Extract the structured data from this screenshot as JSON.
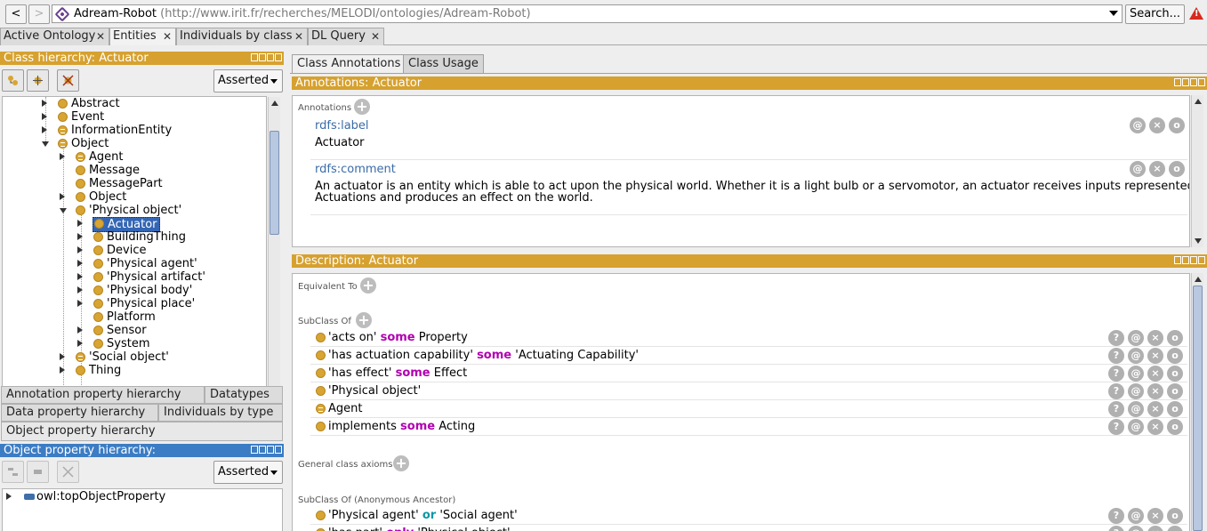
{
  "address_bar": {
    "back": "<",
    "forward": ">",
    "ontology_name": "Adream-Robot",
    "ontology_iri": "(http://www.irit.fr/recherches/MELODI/ontologies/Adream-Robot)",
    "search_label": "Search..."
  },
  "main_tabs": [
    {
      "label": "Active Ontology"
    },
    {
      "label": "Entities"
    },
    {
      "label": "Individuals by class"
    },
    {
      "label": "DL Query"
    }
  ],
  "class_hierarchy": {
    "title": "Class hierarchy: Actuator",
    "mode": "Asserted",
    "nodes": [
      {
        "label": "Abstract"
      },
      {
        "label": "Event"
      },
      {
        "label": "InformationEntity"
      },
      {
        "label": "Object"
      },
      {
        "label": "Agent"
      },
      {
        "label": "Message"
      },
      {
        "label": "MessagePart"
      },
      {
        "label": "Object"
      },
      {
        "label": "'Physical object'"
      },
      {
        "label": "Actuator"
      },
      {
        "label": "BuildingThing"
      },
      {
        "label": "Device"
      },
      {
        "label": "'Physical agent'"
      },
      {
        "label": "'Physical artifact'"
      },
      {
        "label": "'Physical body'"
      },
      {
        "label": "'Physical place'"
      },
      {
        "label": "Platform"
      },
      {
        "label": "Sensor"
      },
      {
        "label": "System"
      },
      {
        "label": "'Social object'"
      },
      {
        "label": "Thing"
      }
    ]
  },
  "lower_tabs": {
    "annotation_property_hierarchy": "Annotation property hierarchy",
    "datatypes": "Datatypes",
    "data_property_hierarchy": "Data property hierarchy",
    "individuals_by_type": "Individuals by type",
    "object_property_hierarchy": "Object property hierarchy"
  },
  "object_property_panel": {
    "title": "Object property hierarchy:",
    "mode": "Asserted",
    "root": "owl:topObjectProperty"
  },
  "right_tabs": [
    {
      "label": "Class Annotations"
    },
    {
      "label": "Class Usage"
    }
  ],
  "annotations": {
    "title": "Annotations: Actuator",
    "section_label": "Annotations",
    "items": [
      {
        "property": "rdfs:label",
        "value": "Actuator"
      },
      {
        "property": "rdfs:comment",
        "value_line1": "An actuator is an entity which is able to act upon the physical world. Whether it is a light bulb or a servomotor, an actuator receives inputs represented by",
        "value_line2": "Actuations and produces an effect on the world."
      }
    ]
  },
  "description": {
    "title": "Description: Actuator",
    "equivalent_to": "Equivalent To",
    "subclass_of": "SubClass Of",
    "subclass_items": [
      {
        "pre": "'acts on' ",
        "kw": "some",
        "post": " Property"
      },
      {
        "pre": "'has actuation capability' ",
        "kw": "some",
        "post": " 'Actuating Capability'"
      },
      {
        "pre": "'has effect' ",
        "kw": "some",
        "post": " Effect"
      },
      {
        "pre": "'Physical object'",
        "kw": "",
        "post": ""
      },
      {
        "pre": "Agent",
        "kw": "",
        "post": ""
      },
      {
        "pre": "implements ",
        "kw": "some",
        "post": " Acting"
      }
    ],
    "general_class_axioms": "General class axioms",
    "anon_ancestor": "SubClass Of (Anonymous Ancestor)",
    "ancestor_items": [
      {
        "pre": "'Physical agent' ",
        "kw": "or",
        "post": " 'Social agent'"
      },
      {
        "pre": "'has part' ",
        "kw": "only",
        "post": " 'Physical object'"
      }
    ]
  },
  "row_buttons": {
    "explain": "?",
    "annotate": "@",
    "delete": "×",
    "edit": "o"
  },
  "colors": {
    "header_gold": "#d6a12f",
    "header_blue": "#3b7cc4",
    "class_icon": "#d8a532",
    "keyword": "#b000b0"
  }
}
